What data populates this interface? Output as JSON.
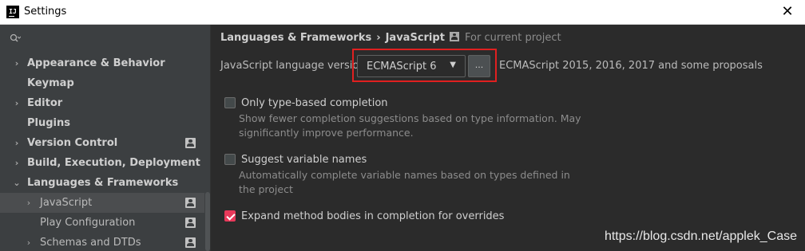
{
  "window": {
    "title": "Settings",
    "logo_text": "IJ"
  },
  "sidebar": {
    "items": [
      {
        "label": "Appearance & Behavior",
        "arrow": "›",
        "bold": true,
        "project": false
      },
      {
        "label": "Keymap",
        "arrow": "",
        "bold": true,
        "project": false
      },
      {
        "label": "Editor",
        "arrow": "›",
        "bold": true,
        "project": false
      },
      {
        "label": "Plugins",
        "arrow": "",
        "bold": true,
        "project": false
      },
      {
        "label": "Version Control",
        "arrow": "›",
        "bold": true,
        "project": true
      },
      {
        "label": "Build, Execution, Deployment",
        "arrow": "›",
        "bold": true,
        "project": false
      },
      {
        "label": "Languages & Frameworks",
        "arrow": "⌄",
        "bold": true,
        "project": false
      },
      {
        "label": "JavaScript",
        "arrow": "›",
        "bold": false,
        "project": true,
        "selected": true
      },
      {
        "label": "Play Configuration",
        "arrow": "",
        "bold": false,
        "project": true
      },
      {
        "label": "Schemas and DTDs",
        "arrow": "›",
        "bold": false,
        "project": true
      }
    ]
  },
  "main": {
    "breadcrumb": [
      "Languages & Frameworks",
      "JavaScript"
    ],
    "breadcrumb_separator": "›",
    "scope_label": "For current project",
    "language_version": {
      "label": "JavaScript language version",
      "value": "ECMAScript 6",
      "more_label": "...",
      "description": "ECMAScript 2015, 2016, 2017 and some proposals"
    },
    "options": [
      {
        "label": "Only type-based completion",
        "checked": false,
        "description": "Show fewer completion suggestions based on type information. May significantly improve performance."
      },
      {
        "label": "Suggest variable names",
        "checked": false,
        "description": "Automatically complete variable names based on types defined in the project"
      },
      {
        "label": "Expand method bodies in completion for overrides",
        "checked": true,
        "description": ""
      }
    ]
  },
  "watermark": "https://blog.csdn.net/applek_Case",
  "colors": {
    "checkbox_checked": "#e8395a",
    "highlight_box": "#e02020",
    "sidebar_bg": "#3c3f41",
    "main_bg": "#2b2b2b"
  }
}
